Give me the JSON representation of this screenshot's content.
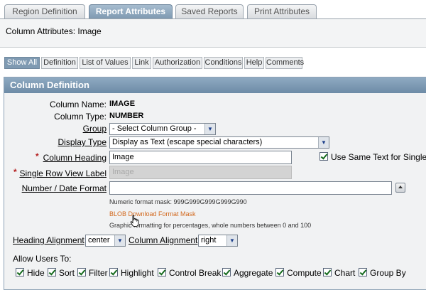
{
  "tabs": [
    {
      "label": "Region Definition",
      "active": false
    },
    {
      "label": "Report Attributes",
      "active": true
    },
    {
      "label": "Saved Reports",
      "active": false
    },
    {
      "label": "Print Attributes",
      "active": false
    }
  ],
  "header": {
    "title": "Column Attributes: Image"
  },
  "subtabs": [
    "Show All",
    "Definition",
    "List of Values",
    "Link",
    "Authorization",
    "Conditions",
    "Help",
    "Comments"
  ],
  "region": {
    "title": "Column Definition",
    "column_name_label": "Column Name:",
    "column_name_value": "IMAGE",
    "column_type_label": "Column Type:",
    "column_type_value": "NUMBER",
    "group_label": "Group",
    "group_value": "- Select Column Group -",
    "display_type_label": "Display Type",
    "display_type_value": "Display as Text (escape special characters)",
    "column_heading_label": "Column Heading",
    "column_heading_value": "Image",
    "use_same_text_label": "Use Same Text for Single I",
    "single_row_label": "Single Row View Label",
    "single_row_value": "Image",
    "number_format_label": "Number / Date Format",
    "number_format_value": "",
    "numeric_mask_note": "Numeric format mask: 999G999G999G999G990",
    "blob_link": "BLOB Download Format Mask",
    "graphic_note": "Graphic formatting for percentages, whole numbers between 0 and 100",
    "heading_alignment_label": "Heading Alignment",
    "heading_alignment_value": "center",
    "column_alignment_label": "Column Alignment",
    "column_alignment_value": "right",
    "allow_users_label": "Allow Users To:",
    "allow": [
      {
        "label": "Hide",
        "checked": true
      },
      {
        "label": "Sort",
        "checked": true
      },
      {
        "label": "Filter",
        "checked": true
      },
      {
        "label": "Highlight",
        "checked": true
      },
      {
        "label": "Control Break",
        "checked": true
      },
      {
        "label": "Aggregate",
        "checked": true
      },
      {
        "label": "Compute",
        "checked": true
      },
      {
        "label": "Chart",
        "checked": true
      },
      {
        "label": "Group By",
        "checked": true
      }
    ]
  },
  "colors": {
    "tab_active": "#7f9ab2",
    "region_header": "#6d8ba6",
    "required_star": "#b41f1f",
    "blob_link": "#d2691e",
    "check": "#146a1c"
  },
  "icons": [
    "chevron-down-icon",
    "checkmark-icon",
    "up-arrow-icon",
    "hand-cursor-icon",
    "required-asterisk-icon"
  ]
}
